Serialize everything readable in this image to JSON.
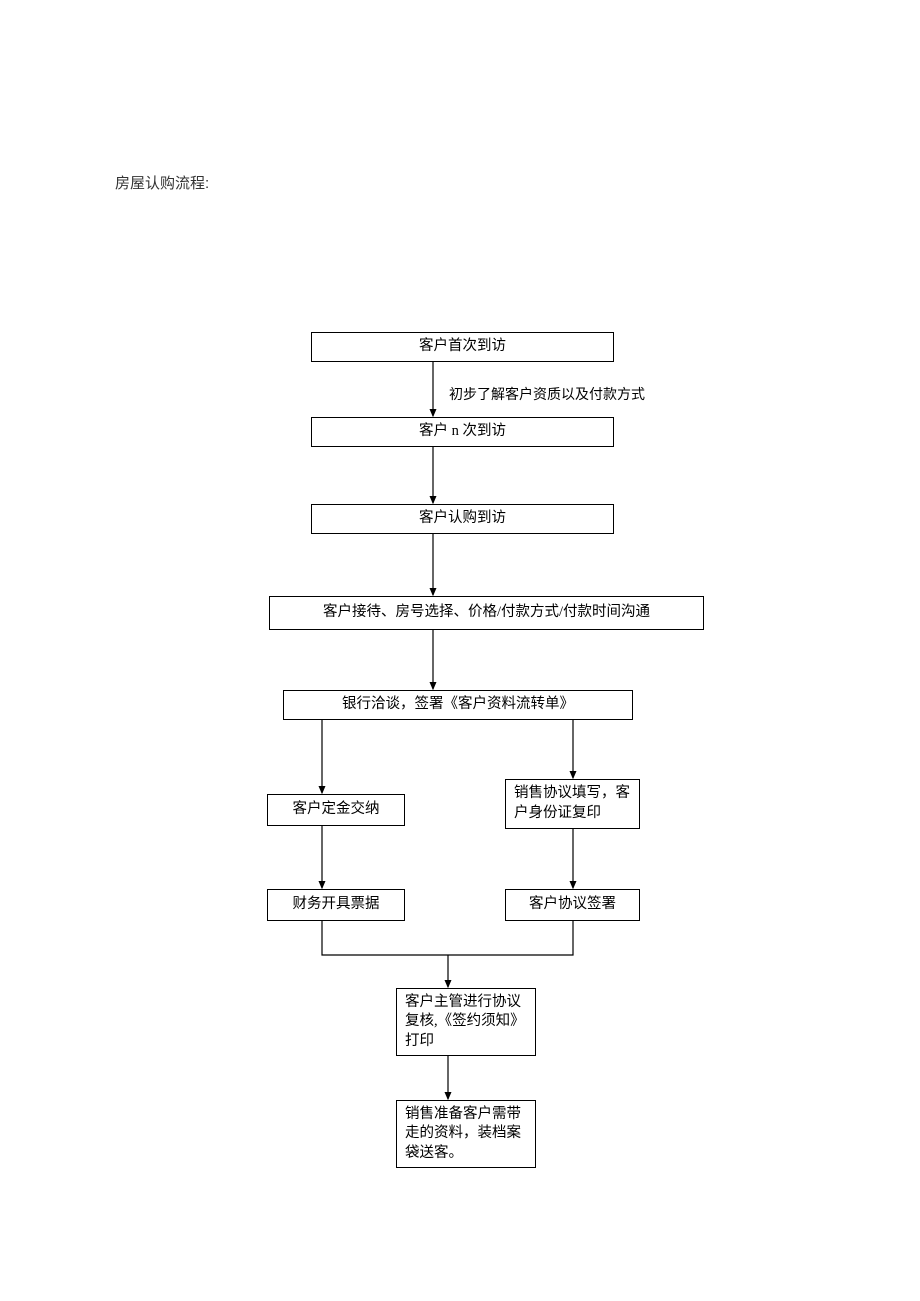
{
  "title": "房屋认购流程:",
  "annotation1": "初步了解客户资质以及付款方式",
  "nodes": {
    "n1": "客户首次到访",
    "n2": "客户 n 次到访",
    "n3": "客户认购到访",
    "n4": "客户接待、房号选择、价格/付款方式/付款时间沟通",
    "n5": "银行洽谈，签署《客户资料流转单》",
    "n6": "客户定金交纳",
    "n7": "销售协议填写，客户身份证复印",
    "n8": "财务开具票据",
    "n9": "客户协议签署",
    "n10": "客户主管进行协议复核,《签约须知》打印",
    "n11": "销售准备客户需带走的资料，装档案袋送客。"
  }
}
